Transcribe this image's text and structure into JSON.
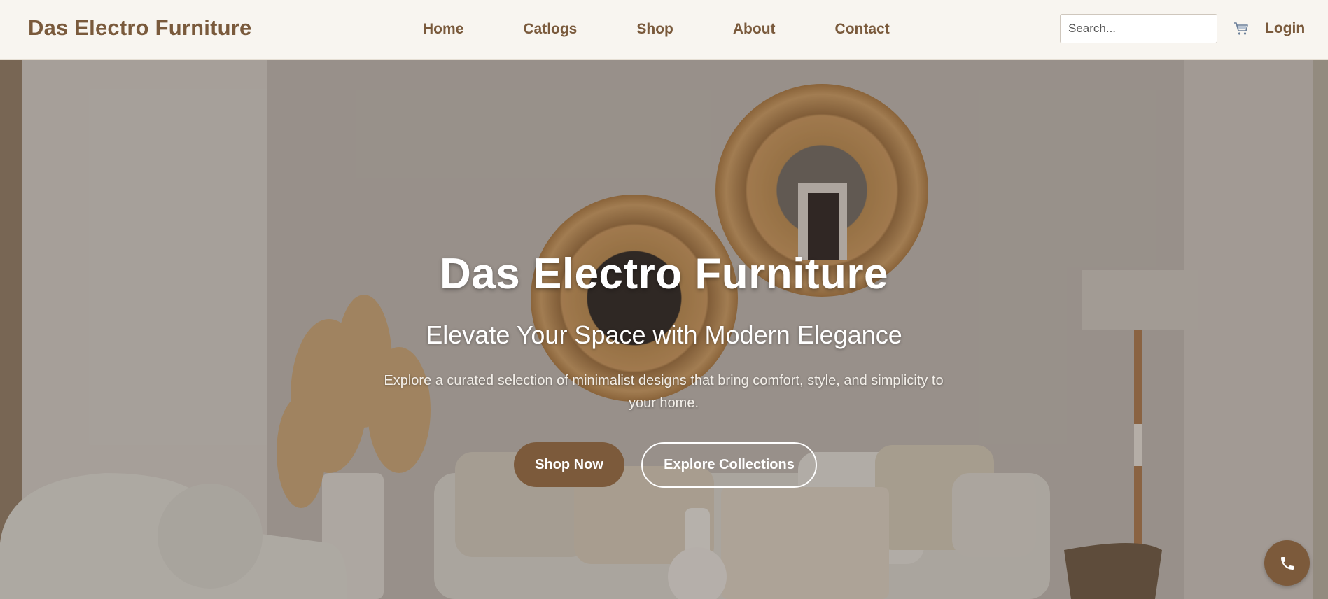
{
  "header": {
    "brand": "Das Electro Furniture",
    "nav": [
      "Home",
      "Catlogs",
      "Shop",
      "About",
      "Contact"
    ],
    "search_placeholder": "Search...",
    "search_value": "",
    "cart_icon": "shopping-cart-icon",
    "login_label": "Login"
  },
  "hero": {
    "title": "Das Electro Furniture",
    "subtitle": "Elevate Your Space with Modern Elegance",
    "text": "Explore a curated selection of minimalist designs that bring comfort, style, and simplicity to your home.",
    "primary_button": "Shop Now",
    "secondary_button": "Explore Collections"
  },
  "floating": {
    "call_icon": "phone-icon"
  },
  "colors": {
    "brand": "#7a5a3c",
    "accent": "#7c5a3b",
    "header_bg": "#f8f5f0",
    "text_light": "#ffffff"
  }
}
